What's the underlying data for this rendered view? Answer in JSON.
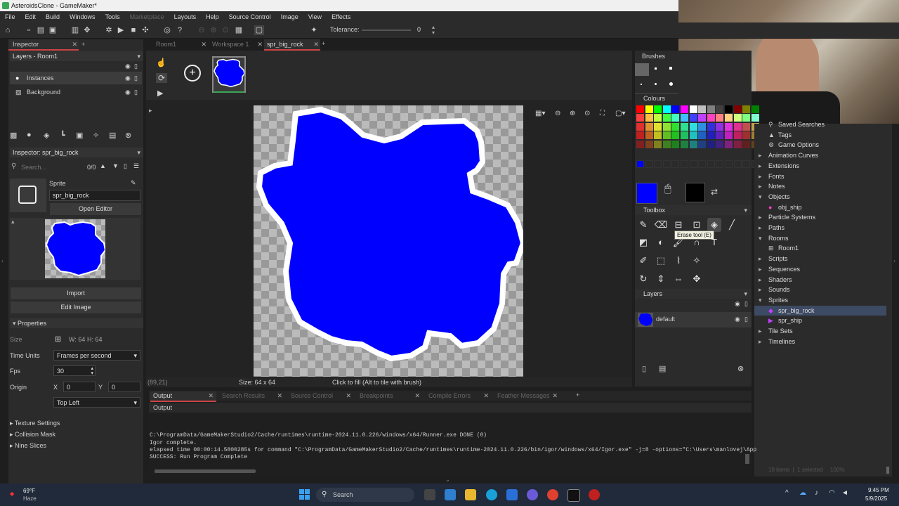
{
  "window": {
    "title": "AsteroidsClone - GameMaker*"
  },
  "menu": {
    "items": [
      "File",
      "Edit",
      "Build",
      "Windows",
      "Tools",
      "Marketplace",
      "Layouts",
      "Help",
      "Source Control",
      "Image",
      "View",
      "Effects"
    ]
  },
  "toolbar": {
    "tolerance_label": "Tolerance:",
    "tolerance_value": "0"
  },
  "inspector": {
    "tab": "Inspector",
    "layers_header": "Layers - Room1",
    "layers": [
      "Instances",
      "Background"
    ],
    "sub_header": "Inspector: spr_big_rock",
    "search_placeholder": "Search...",
    "search_count": "0/0",
    "sprite_label": "Sprite",
    "sprite_name": "spr_big_rock",
    "open_editor": "Open Editor",
    "import": "Import",
    "edit_image": "Edit Image",
    "properties": "Properties",
    "size_label": "Size",
    "size_w": "W: 64",
    "size_h": "H: 64",
    "time_units_label": "Time Units",
    "time_units_value": "Frames per second",
    "fps_label": "Fps",
    "fps_value": "30",
    "origin_label": "Origin",
    "origin_x_label": "X",
    "origin_x": "0",
    "origin_y_label": "Y",
    "origin_y": "0",
    "origin_preset": "Top Left",
    "sections": [
      "Texture Settings",
      "Collision Mask",
      "Nine Slices"
    ]
  },
  "tabs": [
    {
      "label": "Room1",
      "active": false
    },
    {
      "label": "Workspace 1",
      "active": false
    },
    {
      "label": "spr_big_rock",
      "active": true
    }
  ],
  "canvas": {
    "fill_color": "#0000ff"
  },
  "status": {
    "coords": "(89,21)",
    "size": "Size: 64 x 64",
    "hint": "Click to fill (Alt to tile with brush)"
  },
  "right_panel": {
    "brushes": "Brushes",
    "colours": "Colours",
    "toolbox": "Toolbox",
    "tooltip": "Erase tool (E)",
    "layers": "Layers",
    "layer_name": "default",
    "primary_color": "#0000ff",
    "secondary_color": "#000000"
  },
  "asset_tree": {
    "items": [
      {
        "label": "Saved Searches",
        "indent": 1
      },
      {
        "label": "Tags",
        "indent": 1
      },
      {
        "label": "Game Options",
        "indent": 1
      },
      {
        "label": "Animation Curves",
        "indent": 0
      },
      {
        "label": "Extensions",
        "indent": 0
      },
      {
        "label": "Fonts",
        "indent": 0
      },
      {
        "label": "Notes",
        "indent": 0
      },
      {
        "label": "Objects",
        "indent": 0
      },
      {
        "label": "obj_ship",
        "indent": 1
      },
      {
        "label": "Particle Systems",
        "indent": 0
      },
      {
        "label": "Paths",
        "indent": 0
      },
      {
        "label": "Rooms",
        "indent": 0
      },
      {
        "label": "Room1",
        "indent": 1
      },
      {
        "label": "Scripts",
        "indent": 0
      },
      {
        "label": "Sequences",
        "indent": 0
      },
      {
        "label": "Shaders",
        "indent": 0
      },
      {
        "label": "Sounds",
        "indent": 0
      },
      {
        "label": "Sprites",
        "indent": 0
      },
      {
        "label": "spr_big_rock",
        "indent": 1
      },
      {
        "label": "spr_ship",
        "indent": 1
      },
      {
        "label": "Tile Sets",
        "indent": 0
      },
      {
        "label": "Timelines",
        "indent": 0
      }
    ],
    "footer_items": "19 items",
    "footer_selected": "1 selected",
    "zoom": "100%"
  },
  "output": {
    "tabs": [
      "Output",
      "Search Results",
      "Source Control",
      "Breakpoints",
      "Compile Errors",
      "Feather Messages"
    ],
    "sub_label": "Output",
    "lines": [
      "C:\\ProgramData/GameMakerStudio2/Cache/runtimes\\runtime-2024.11.0.226/windows/x64/Runner.exe DONE (0)",
      "Igor complete.",
      "elapsed time 00:00:14.5800285s for command \"C:\\ProgramData/GameMakerStudio2/Cache/runtimes\\runtime-2024.11.0.226/bin/igor/windows/x64/Igor.exe\" -j=8  -options=\"C:\\Users\\manlovej\\App",
      "SUCCESS: Run Program Complete"
    ]
  },
  "taskbar": {
    "weather_temp": "69°F",
    "weather_desc": "Haze",
    "search": "Search",
    "time": "9:45 PM",
    "date": "5/9/2025"
  }
}
